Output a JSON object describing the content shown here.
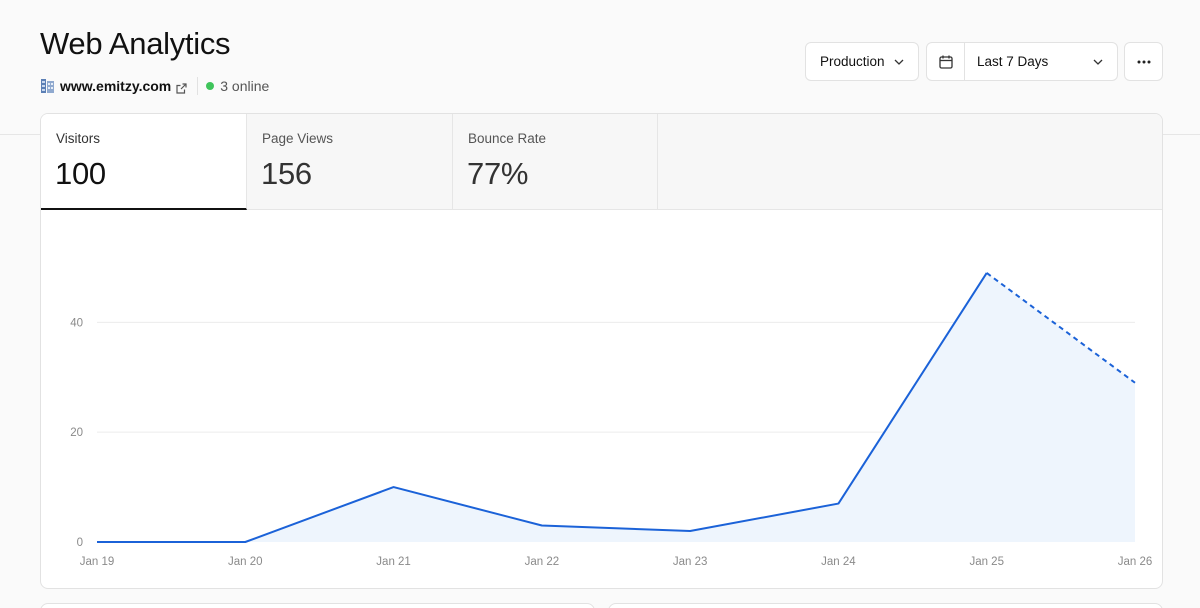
{
  "header": {
    "title": "Web Analytics",
    "site": {
      "domain": "www.emitzy.com",
      "online_text": "3 online"
    }
  },
  "controls": {
    "environment": "Production",
    "date_range": "Last 7 Days"
  },
  "tabs": [
    {
      "label": "Visitors",
      "value": "100",
      "active": true
    },
    {
      "label": "Page Views",
      "value": "156",
      "active": false
    },
    {
      "label": "Bounce Rate",
      "value": "77%",
      "active": false
    }
  ],
  "colors": {
    "line": "#1b62d8",
    "area": "#eef5fd",
    "online": "#3fc45b"
  },
  "chart_data": {
    "type": "area",
    "x": [
      "Jan 19",
      "Jan 20",
      "Jan 21",
      "Jan 22",
      "Jan 23",
      "Jan 24",
      "Jan 25",
      "Jan 26"
    ],
    "series": [
      {
        "values": [
          0,
          0,
          10,
          3,
          2,
          7,
          49,
          29
        ],
        "dashed_from_index": 6
      }
    ],
    "yticks": [
      0,
      20,
      40
    ],
    "ylim": [
      0,
      57
    ],
    "grid": true
  }
}
